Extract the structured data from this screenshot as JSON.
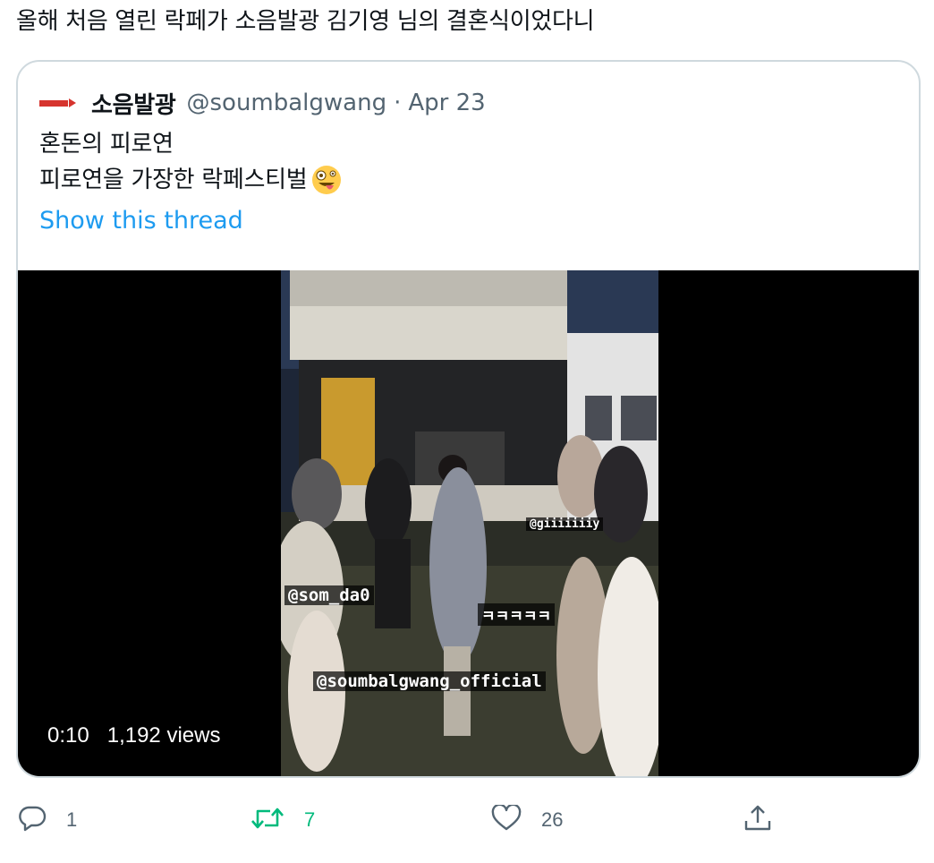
{
  "tweet": {
    "text": "올해 처음 열린 락페가 소음발광 김기영 님의 결혼식이었다니"
  },
  "quote": {
    "avatar_logo_text": "소음발광",
    "name": "소음발광",
    "handle": "@soumbalgwang",
    "dot": "·",
    "date": "Apr 23",
    "lines": [
      "혼돈의 피로연",
      "피로연을 가장한 락페스티벌"
    ],
    "emoji": "zany-face-emoji",
    "show_thread": "Show this thread"
  },
  "video": {
    "time": "0:10",
    "views": "1,192 views",
    "stickers": {
      "giii": "@giiiiiiiy",
      "somda": "@som_da0",
      "kkk": "ㅋㅋㅋㅋㅋ",
      "official": "@soumbalgwang_official"
    }
  },
  "actions": {
    "reply": {
      "icon": "reply-icon",
      "count": "1"
    },
    "retweet": {
      "icon": "retweet-icon",
      "count": "7",
      "color": "#00ba7c"
    },
    "like": {
      "icon": "heart-icon",
      "count": "26"
    },
    "share": {
      "icon": "share-icon"
    }
  },
  "colors": {
    "link": "#1d9bf0",
    "secondary": "#536471",
    "border": "#cfd9de"
  }
}
